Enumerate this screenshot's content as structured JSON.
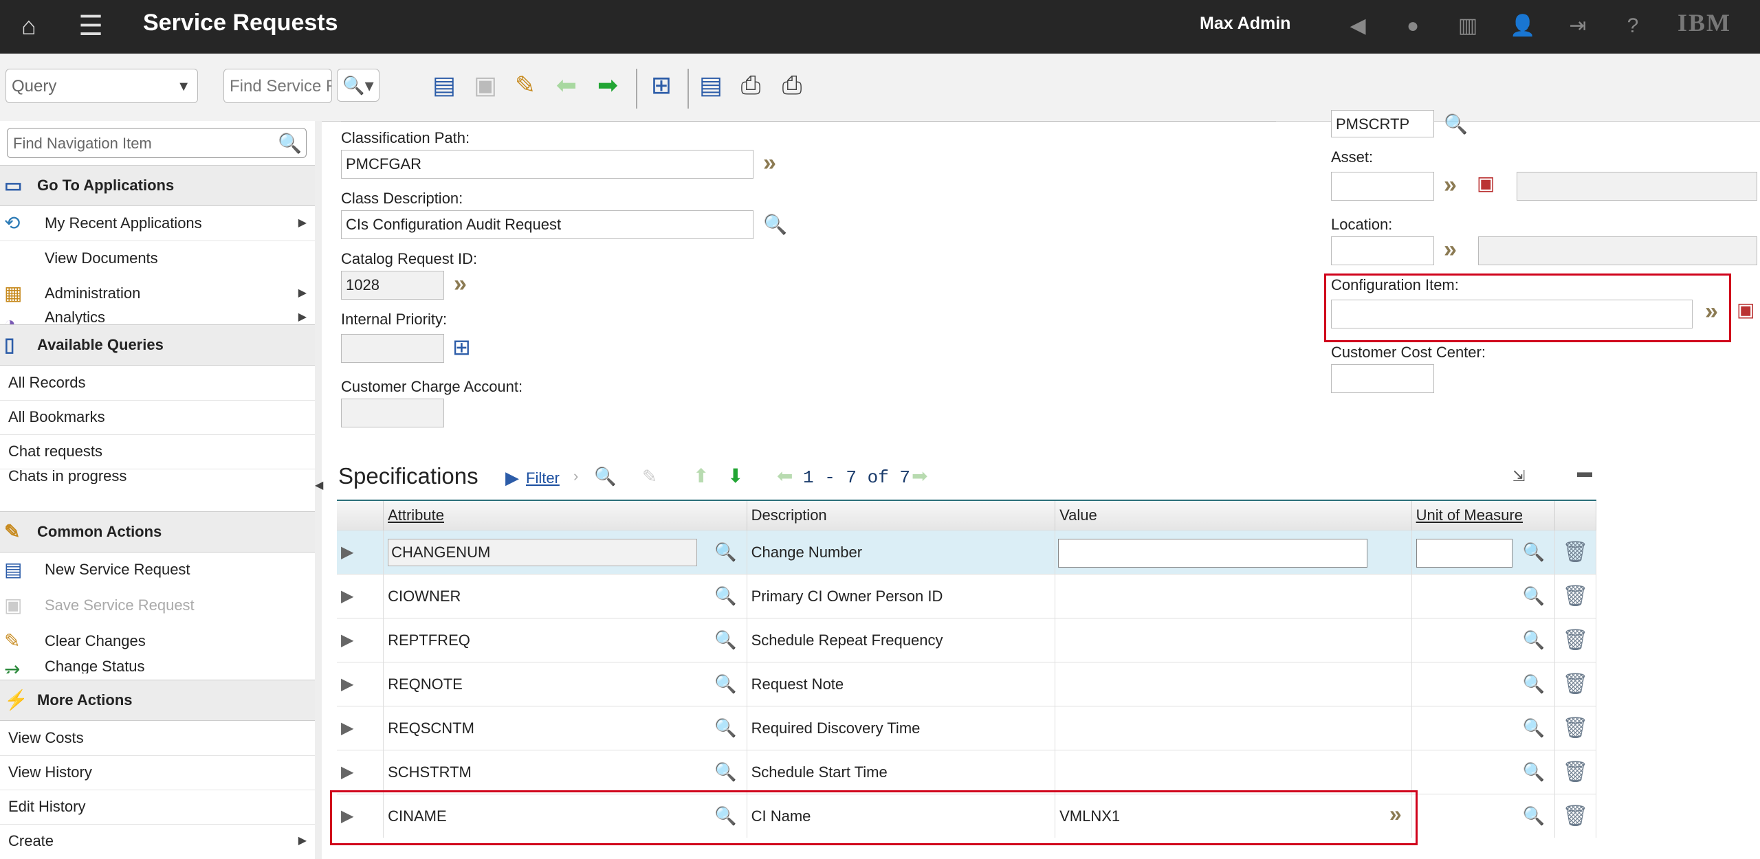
{
  "header": {
    "title": "Service Requests",
    "user": "Max Admin",
    "brand": "IBM",
    "icons": [
      "home-icon",
      "menu-icon",
      "megaphone-icon",
      "chat-icon",
      "reports-icon",
      "profile-icon",
      "signout-icon",
      "help-icon"
    ]
  },
  "toolbar": {
    "query_select": "Query",
    "find_placeholder": "Find Service Re"
  },
  "nav": {
    "search_placeholder": "Find Navigation Item",
    "go_to": "Go To Applications",
    "go_items": [
      "My Recent Applications",
      "View Documents",
      "Administration",
      "Analytics"
    ],
    "queries_title": "Available Queries",
    "queries": [
      "All Records",
      "All Bookmarks",
      "Chat requests",
      "Chats in progress"
    ],
    "common_title": "Common Actions",
    "common": [
      "New Service Request",
      "Save Service Request",
      "Clear Changes",
      "Change Status"
    ],
    "more_title": "More Actions",
    "more": [
      "View Costs",
      "View History",
      "Edit History",
      "Create"
    ]
  },
  "form": {
    "class_path_label": "Classification Path:",
    "class_path_value": "PMCFGAR",
    "class_desc_label": "Class Description:",
    "class_desc_value": "CIs Configuration Audit Request",
    "catalog_label": "Catalog Request ID:",
    "catalog_value": "1028",
    "priority_label": "Internal Priority:",
    "charge_label": "Customer Charge Account:",
    "top_right_value": "PMSCRTP",
    "asset_label": "Asset:",
    "location_label": "Location:",
    "ci_label": "Configuration Item:",
    "cost_label": "Customer Cost Center:"
  },
  "spec": {
    "title": "Specifications",
    "filter": "Filter",
    "pager": "1 - 7 of 7",
    "headers": {
      "attribute": "Attribute",
      "description": "Description",
      "value": "Value",
      "uom": "Unit of Measure"
    },
    "rows": [
      {
        "attr": "CHANGENUM",
        "desc": "Change Number",
        "value": ""
      },
      {
        "attr": "CIOWNER",
        "desc": "Primary CI Owner Person ID",
        "value": ""
      },
      {
        "attr": "REPTFREQ",
        "desc": "Schedule Repeat Frequency",
        "value": ""
      },
      {
        "attr": "REQNOTE",
        "desc": "Request Note",
        "value": ""
      },
      {
        "attr": "REQSCNTM",
        "desc": "Required Discovery Time",
        "value": ""
      },
      {
        "attr": "SCHSTRTM",
        "desc": "Schedule Start Time",
        "value": ""
      },
      {
        "attr": "CINAME",
        "desc": "CI Name",
        "value": "VMLNX1"
      }
    ]
  },
  "colors": {
    "topbar": "#262626",
    "highlight": "#d0021b",
    "selected_row": "#dbeef6"
  }
}
